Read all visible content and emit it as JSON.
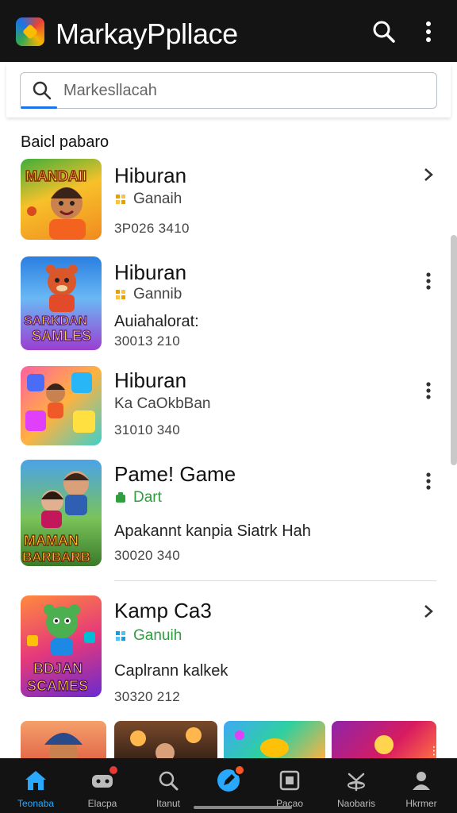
{
  "app": {
    "title": "MarkayPpllace",
    "logo_icon": "app-logo-icon"
  },
  "search": {
    "placeholder": "Markesllacah"
  },
  "section": {
    "title": "Baicl pabaro"
  },
  "items": [
    {
      "title": "Hiburan",
      "sub": "Ganaih",
      "desc": "",
      "meta": "3P026 3410",
      "action": "chevron-right-icon",
      "sub_color": "#e6a100",
      "thumb_text": "MANDAII"
    },
    {
      "title": "Hiburan",
      "sub": "Gannib",
      "desc": "Auiahalorat:",
      "meta": "30013 210",
      "action": "more-vert-icon",
      "sub_color": "#e6a100",
      "thumb_text": "SARKDAN SAMLES"
    },
    {
      "title": "Hiburan",
      "sub": "Ka CaOkbBan",
      "desc": "",
      "meta": "31010 340",
      "action": "more-vert-icon",
      "sub_color": "",
      "thumb_text": ""
    },
    {
      "title": "Pame! Game",
      "sub": "Dart",
      "desc": "Apakannt kanpia Siatrk Hah",
      "meta": "30020 340",
      "action": "more-vert-icon",
      "sub_color": "#2e9e3f",
      "thumb_text": "MAMAN BARBARB"
    },
    {
      "title": "Kamp Ca3",
      "sub": "Ganuih",
      "desc": "Caplrann kalkek",
      "meta": "30320 212",
      "action": "chevron-right-icon",
      "sub_color": "#1e9bd7",
      "thumb_text": "BDJAN SCAMES"
    }
  ],
  "nav": [
    {
      "label": "Teonaba",
      "icon": "home-icon",
      "active": true
    },
    {
      "label": "Elacpa",
      "icon": "games-controller-icon",
      "badge": true
    },
    {
      "label": "Itanut",
      "icon": "search-icon"
    },
    {
      "label": "",
      "icon": "edit-pen-icon",
      "badge": true
    },
    {
      "label": "Pacao",
      "icon": "apps-icon"
    },
    {
      "label": "Naobaris",
      "icon": "leaf-icon"
    },
    {
      "label": "Hkrmer",
      "icon": "person-icon"
    }
  ],
  "colors": {
    "appbar": "#141414",
    "accent": "#1a73e8",
    "nav_active": "#29a8ff",
    "badge": "#e53935"
  }
}
